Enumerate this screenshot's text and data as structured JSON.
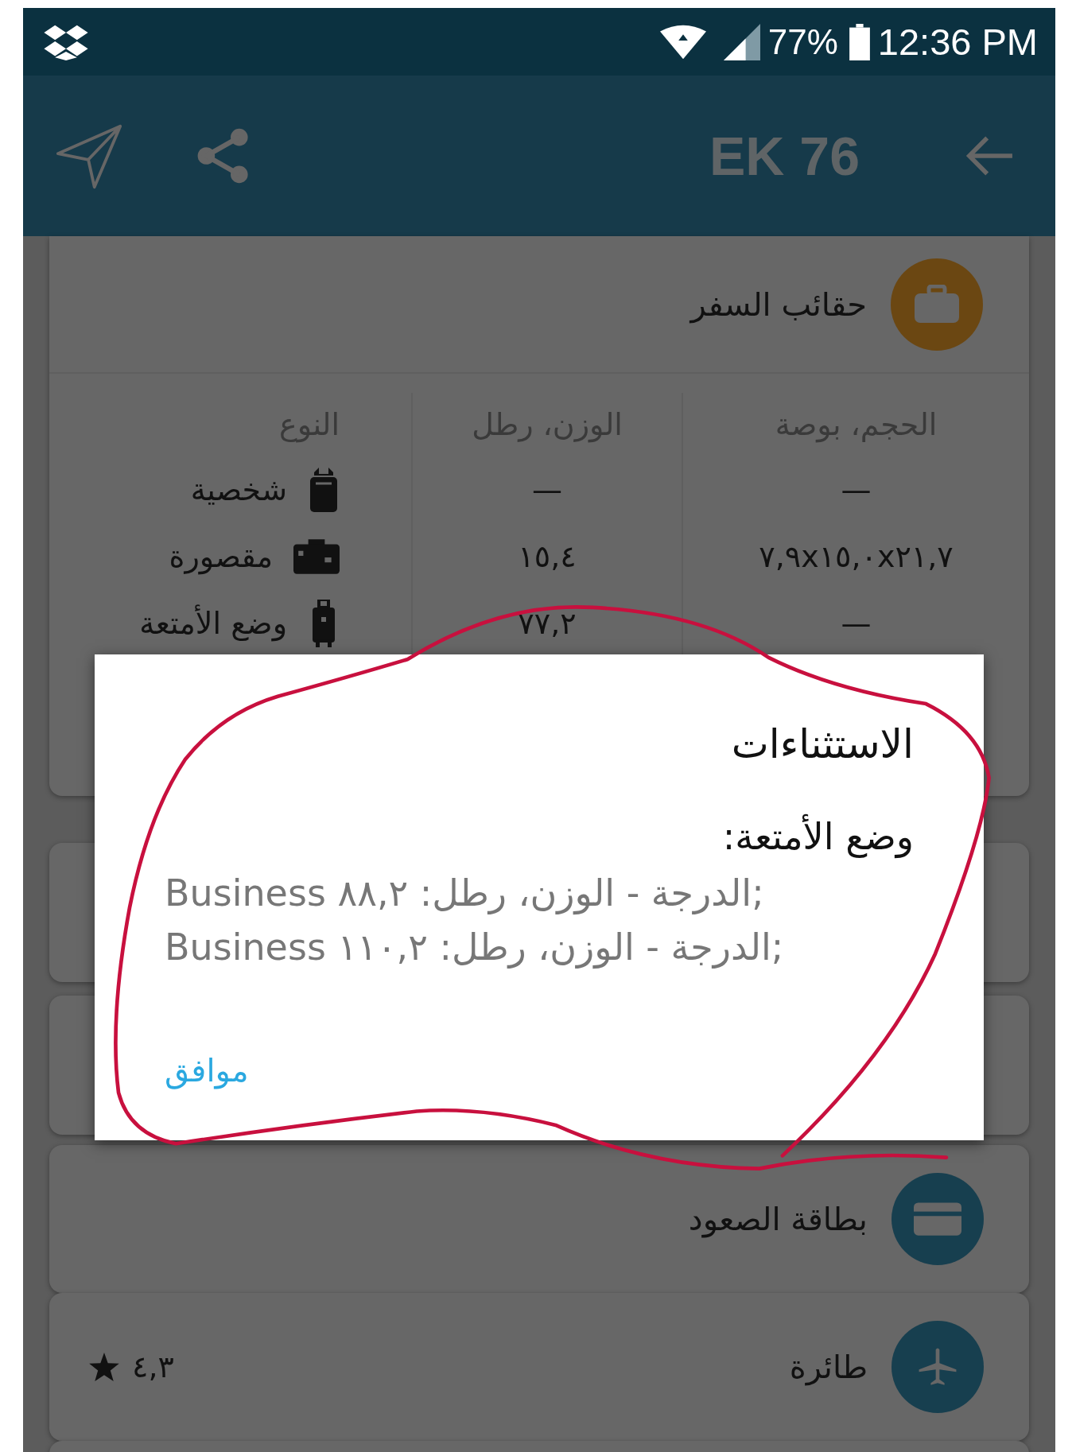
{
  "status_bar": {
    "battery": "77%",
    "time": "12:36 PM"
  },
  "toolbar": {
    "title": "EK 76"
  },
  "baggage_card": {
    "title": "حقائب السفر",
    "columns": [
      "الحجم، بوصة",
      "الوزن، رطل",
      "النوع"
    ],
    "rows": [
      {
        "kind": "personal",
        "size": "—",
        "weight": "—",
        "type": "شخصية"
      },
      {
        "kind": "cabin",
        "size": "٧,٩x١٥,٠x٢١,٧",
        "weight": "١٥,٤",
        "type": "مقصورة"
      },
      {
        "kind": "checked",
        "size": "—",
        "weight": "٧٧,٢",
        "type": "وضع الأمتعة"
      }
    ]
  },
  "list_cards": [
    {
      "kind": "boarding",
      "title": "بطاقة الصعود"
    },
    {
      "kind": "aircraft",
      "title": "طائرة",
      "rating": "٤,٣"
    }
  ],
  "dialog": {
    "title": "الاستثناءات",
    "subtitle": "وضع الأمتعة:",
    "lines": [
      "Business الدرجة - الوزن، رطل: ٨٨,٢;",
      "Business الدرجة - الوزن، رطل: ١١٠,٢;"
    ],
    "button": "موافق"
  }
}
